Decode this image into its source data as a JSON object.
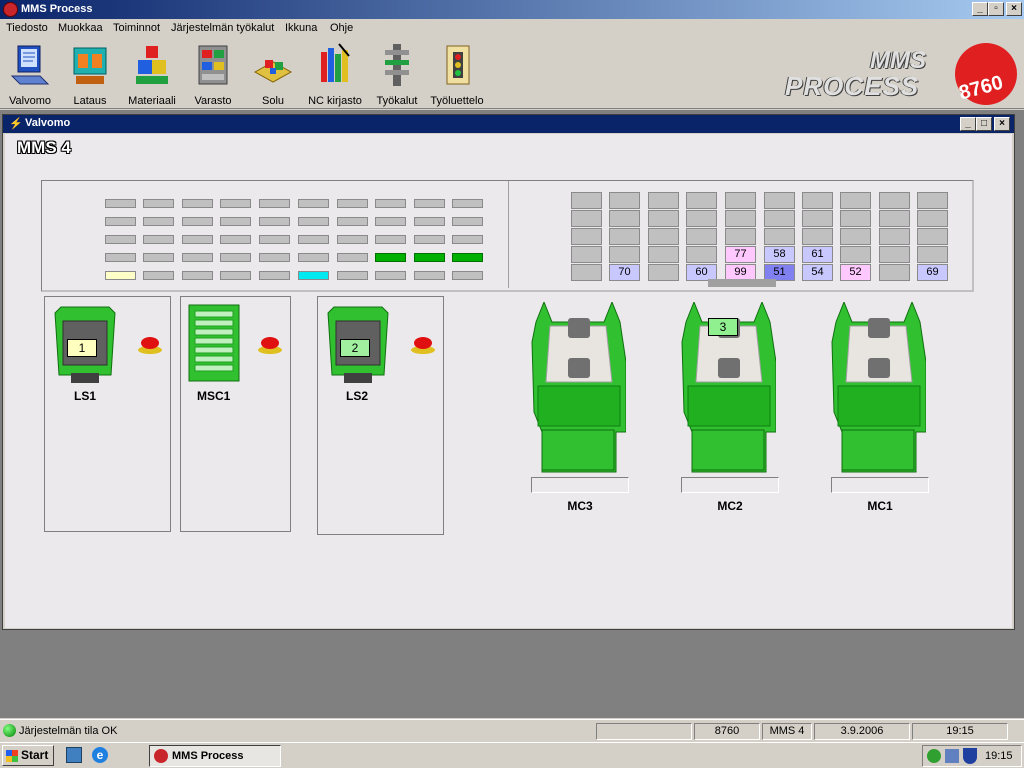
{
  "app": {
    "title": "MMS Process"
  },
  "menu": {
    "items": [
      "Tiedosto",
      "Muokkaa",
      "Toiminnot",
      "Järjestelmän työkalut",
      "Ikkuna",
      "Ohje"
    ]
  },
  "toolbar": {
    "items": [
      {
        "label": "Valvomo",
        "icon": "monitor-icon"
      },
      {
        "label": "Lataus",
        "icon": "loading-icon"
      },
      {
        "label": "Materiaali",
        "icon": "material-icon"
      },
      {
        "label": "Varasto",
        "icon": "storage-icon"
      },
      {
        "label": "Solu",
        "icon": "cell-icon"
      },
      {
        "label": "NC kirjasto",
        "icon": "nc-library-icon"
      },
      {
        "label": "Työkalut",
        "icon": "tools-icon"
      },
      {
        "label": "Työluettelo",
        "icon": "worklist-icon"
      }
    ]
  },
  "logo": {
    "line1": "MMS",
    "line2": "PROCESS",
    "number": "8760"
  },
  "child_window": {
    "title": "Valvomo",
    "heading": "MMS 4"
  },
  "left_grid": {
    "rows": [
      [
        "gray",
        "gray",
        "gray",
        "gray",
        "gray",
        "gray",
        "gray",
        "gray",
        "gray",
        "gray"
      ],
      [
        "gray",
        "gray",
        "gray",
        "gray",
        "gray",
        "gray",
        "gray",
        "gray",
        "gray",
        "gray"
      ],
      [
        "gray",
        "gray",
        "gray",
        "gray",
        "gray",
        "gray",
        "gray",
        "gray",
        "gray",
        "gray"
      ],
      [
        "gray",
        "gray",
        "gray",
        "gray",
        "gray",
        "gray",
        "gray",
        "green",
        "green",
        "green"
      ],
      [
        "yellow",
        "gray",
        "gray",
        "gray",
        "gray",
        "cyan",
        "gray",
        "gray",
        "gray",
        "gray"
      ]
    ]
  },
  "right_grid": {
    "rows": [
      [
        "",
        "",
        "",
        "",
        "",
        "",
        "",
        "",
        "",
        ""
      ],
      [
        "",
        "",
        "",
        "",
        "",
        "",
        "",
        "",
        "",
        ""
      ],
      [
        "",
        "",
        "",
        "",
        "",
        "",
        "",
        "",
        "",
        ""
      ],
      [
        "",
        "",
        "",
        "",
        "77",
        "58",
        "61",
        "",
        "",
        ""
      ],
      [
        "",
        "70",
        "",
        "60",
        "99",
        "51",
        "54",
        "52",
        "",
        "69"
      ]
    ],
    "styles": [
      [
        "",
        "",
        "",
        "",
        "",
        "",
        "",
        "",
        "",
        ""
      ],
      [
        "",
        "",
        "",
        "",
        "",
        "",
        "",
        "",
        "",
        ""
      ],
      [
        "",
        "",
        "",
        "",
        "",
        "",
        "",
        "",
        "",
        ""
      ],
      [
        "",
        "",
        "",
        "",
        "pink",
        "blue",
        "blue",
        "",
        "",
        ""
      ],
      [
        "",
        "blue",
        "",
        "blue",
        "pink",
        "darkblue",
        "blue",
        "pink",
        "",
        "blue"
      ]
    ]
  },
  "stations": [
    {
      "label": "LS1",
      "number": "1",
      "numcolor": "#ffffc0"
    },
    {
      "label": "MSC1",
      "number": "",
      "numcolor": ""
    },
    {
      "label": "LS2",
      "number": "2",
      "numcolor": "#a0f0a0"
    }
  ],
  "machines": [
    {
      "label": "MC3",
      "pallet": ""
    },
    {
      "label": "MC2",
      "pallet": "3"
    },
    {
      "label": "MC1",
      "pallet": ""
    }
  ],
  "statusbar": {
    "status": "Järjestelmän tila OK",
    "code": "8760",
    "system": "MMS 4",
    "date": "3.9.2006",
    "time": "19:15"
  },
  "taskbar": {
    "start": "Start",
    "task": "MMS Process",
    "clock": "19:15"
  },
  "colors": {
    "gray": "#c0c0c0",
    "green": "#00b000",
    "yellow": "#ffffc8",
    "cyan": "#00e8f0",
    "pink": "#ffc8ff",
    "blue": "#c8c8ff",
    "darkblue": "#8080f0"
  }
}
